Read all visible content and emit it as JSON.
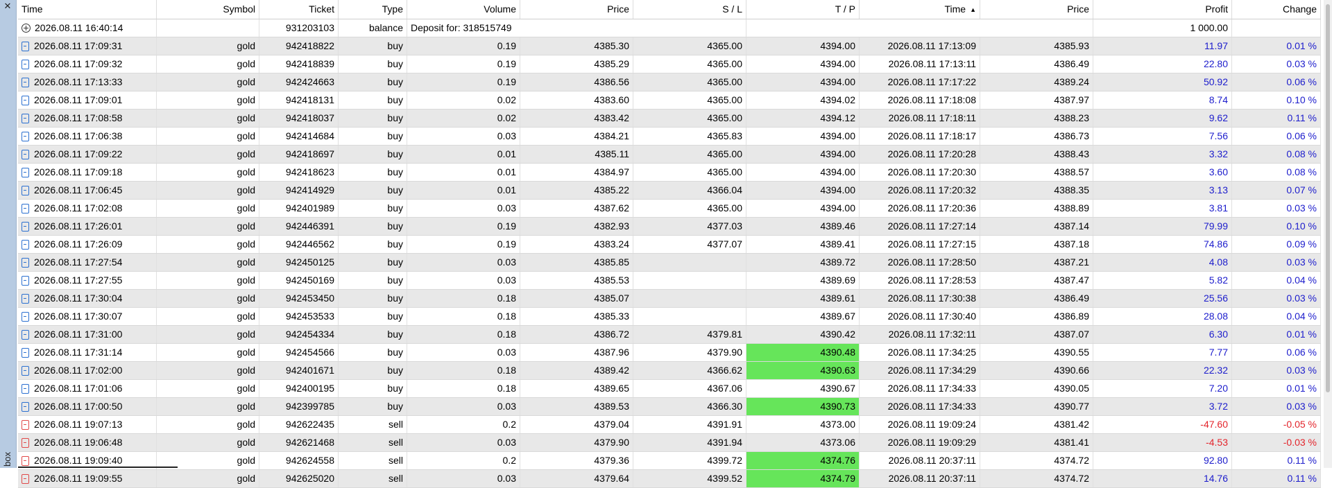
{
  "sidebar": {
    "close_glyph": "✕",
    "label": "box"
  },
  "columns": [
    "Time",
    "Symbol",
    "Ticket",
    "Type",
    "Volume",
    "Price",
    "S / L",
    "T / P",
    "Time",
    "Price",
    "Profit",
    "Change"
  ],
  "sort_indicator": "▲",
  "balance_row": {
    "time": "2026.08.11 16:40:14",
    "ticket": "931203103",
    "type": "balance",
    "comment": "Deposit for: 318515749",
    "profit": "1 000.00"
  },
  "rows": [
    {
      "time": "2026.08.11 17:09:31",
      "symbol": "gold",
      "ticket": "942418822",
      "type": "buy",
      "volume": "0.19",
      "price": "4385.30",
      "sl": "4365.00",
      "tp": "4394.00",
      "close_time": "2026.08.11 17:13:09",
      "close_price": "4385.93",
      "profit": "11.97",
      "change": "0.01 %",
      "tp_hit": false
    },
    {
      "time": "2026.08.11 17:09:32",
      "symbol": "gold",
      "ticket": "942418839",
      "type": "buy",
      "volume": "0.19",
      "price": "4385.29",
      "sl": "4365.00",
      "tp": "4394.00",
      "close_time": "2026.08.11 17:13:11",
      "close_price": "4386.49",
      "profit": "22.80",
      "change": "0.03 %",
      "tp_hit": false
    },
    {
      "time": "2026.08.11 17:13:33",
      "symbol": "gold",
      "ticket": "942424663",
      "type": "buy",
      "volume": "0.19",
      "price": "4386.56",
      "sl": "4365.00",
      "tp": "4394.00",
      "close_time": "2026.08.11 17:17:22",
      "close_price": "4389.24",
      "profit": "50.92",
      "change": "0.06 %",
      "tp_hit": false
    },
    {
      "time": "2026.08.11 17:09:01",
      "symbol": "gold",
      "ticket": "942418131",
      "type": "buy",
      "volume": "0.02",
      "price": "4383.60",
      "sl": "4365.00",
      "tp": "4394.02",
      "close_time": "2026.08.11 17:18:08",
      "close_price": "4387.97",
      "profit": "8.74",
      "change": "0.10 %",
      "tp_hit": false
    },
    {
      "time": "2026.08.11 17:08:58",
      "symbol": "gold",
      "ticket": "942418037",
      "type": "buy",
      "volume": "0.02",
      "price": "4383.42",
      "sl": "4365.00",
      "tp": "4394.12",
      "close_time": "2026.08.11 17:18:11",
      "close_price": "4388.23",
      "profit": "9.62",
      "change": "0.11 %",
      "tp_hit": false
    },
    {
      "time": "2026.08.11 17:06:38",
      "symbol": "gold",
      "ticket": "942414684",
      "type": "buy",
      "volume": "0.03",
      "price": "4384.21",
      "sl": "4365.83",
      "tp": "4394.00",
      "close_time": "2026.08.11 17:18:17",
      "close_price": "4386.73",
      "profit": "7.56",
      "change": "0.06 %",
      "tp_hit": false
    },
    {
      "time": "2026.08.11 17:09:22",
      "symbol": "gold",
      "ticket": "942418697",
      "type": "buy",
      "volume": "0.01",
      "price": "4385.11",
      "sl": "4365.00",
      "tp": "4394.00",
      "close_time": "2026.08.11 17:20:28",
      "close_price": "4388.43",
      "profit": "3.32",
      "change": "0.08 %",
      "tp_hit": false
    },
    {
      "time": "2026.08.11 17:09:18",
      "symbol": "gold",
      "ticket": "942418623",
      "type": "buy",
      "volume": "0.01",
      "price": "4384.97",
      "sl": "4365.00",
      "tp": "4394.00",
      "close_time": "2026.08.11 17:20:30",
      "close_price": "4388.57",
      "profit": "3.60",
      "change": "0.08 %",
      "tp_hit": false
    },
    {
      "time": "2026.08.11 17:06:45",
      "symbol": "gold",
      "ticket": "942414929",
      "type": "buy",
      "volume": "0.01",
      "price": "4385.22",
      "sl": "4366.04",
      "tp": "4394.00",
      "close_time": "2026.08.11 17:20:32",
      "close_price": "4388.35",
      "profit": "3.13",
      "change": "0.07 %",
      "tp_hit": false
    },
    {
      "time": "2026.08.11 17:02:08",
      "symbol": "gold",
      "ticket": "942401989",
      "type": "buy",
      "volume": "0.03",
      "price": "4387.62",
      "sl": "4365.00",
      "tp": "4394.00",
      "close_time": "2026.08.11 17:20:36",
      "close_price": "4388.89",
      "profit": "3.81",
      "change": "0.03 %",
      "tp_hit": false
    },
    {
      "time": "2026.08.11 17:26:01",
      "symbol": "gold",
      "ticket": "942446391",
      "type": "buy",
      "volume": "0.19",
      "price": "4382.93",
      "sl": "4377.03",
      "tp": "4389.46",
      "close_time": "2026.08.11 17:27:14",
      "close_price": "4387.14",
      "profit": "79.99",
      "change": "0.10 %",
      "tp_hit": false
    },
    {
      "time": "2026.08.11 17:26:09",
      "symbol": "gold",
      "ticket": "942446562",
      "type": "buy",
      "volume": "0.19",
      "price": "4383.24",
      "sl": "4377.07",
      "tp": "4389.41",
      "close_time": "2026.08.11 17:27:15",
      "close_price": "4387.18",
      "profit": "74.86",
      "change": "0.09 %",
      "tp_hit": false
    },
    {
      "time": "2026.08.11 17:27:54",
      "symbol": "gold",
      "ticket": "942450125",
      "type": "buy",
      "volume": "0.03",
      "price": "4385.85",
      "sl": "",
      "tp": "4389.72",
      "close_time": "2026.08.11 17:28:50",
      "close_price": "4387.21",
      "profit": "4.08",
      "change": "0.03 %",
      "tp_hit": false
    },
    {
      "time": "2026.08.11 17:27:55",
      "symbol": "gold",
      "ticket": "942450169",
      "type": "buy",
      "volume": "0.03",
      "price": "4385.53",
      "sl": "",
      "tp": "4389.69",
      "close_time": "2026.08.11 17:28:53",
      "close_price": "4387.47",
      "profit": "5.82",
      "change": "0.04 %",
      "tp_hit": false
    },
    {
      "time": "2026.08.11 17:30:04",
      "symbol": "gold",
      "ticket": "942453450",
      "type": "buy",
      "volume": "0.18",
      "price": "4385.07",
      "sl": "",
      "tp": "4389.61",
      "close_time": "2026.08.11 17:30:38",
      "close_price": "4386.49",
      "profit": "25.56",
      "change": "0.03 %",
      "tp_hit": false
    },
    {
      "time": "2026.08.11 17:30:07",
      "symbol": "gold",
      "ticket": "942453533",
      "type": "buy",
      "volume": "0.18",
      "price": "4385.33",
      "sl": "",
      "tp": "4389.67",
      "close_time": "2026.08.11 17:30:40",
      "close_price": "4386.89",
      "profit": "28.08",
      "change": "0.04 %",
      "tp_hit": false
    },
    {
      "time": "2026.08.11 17:31:00",
      "symbol": "gold",
      "ticket": "942454334",
      "type": "buy",
      "volume": "0.18",
      "price": "4386.72",
      "sl": "4379.81",
      "tp": "4390.42",
      "close_time": "2026.08.11 17:32:11",
      "close_price": "4387.07",
      "profit": "6.30",
      "change": "0.01 %",
      "tp_hit": false
    },
    {
      "time": "2026.08.11 17:31:14",
      "symbol": "gold",
      "ticket": "942454566",
      "type": "buy",
      "volume": "0.03",
      "price": "4387.96",
      "sl": "4379.90",
      "tp": "4390.48",
      "close_time": "2026.08.11 17:34:25",
      "close_price": "4390.55",
      "profit": "7.77",
      "change": "0.06 %",
      "tp_hit": true
    },
    {
      "time": "2026.08.11 17:02:00",
      "symbol": "gold",
      "ticket": "942401671",
      "type": "buy",
      "volume": "0.18",
      "price": "4389.42",
      "sl": "4366.62",
      "tp": "4390.63",
      "close_time": "2026.08.11 17:34:29",
      "close_price": "4390.66",
      "profit": "22.32",
      "change": "0.03 %",
      "tp_hit": true
    },
    {
      "time": "2026.08.11 17:01:06",
      "symbol": "gold",
      "ticket": "942400195",
      "type": "buy",
      "volume": "0.18",
      "price": "4389.65",
      "sl": "4367.06",
      "tp": "4390.67",
      "close_time": "2026.08.11 17:34:33",
      "close_price": "4390.05",
      "profit": "7.20",
      "change": "0.01 %",
      "tp_hit": false
    },
    {
      "time": "2026.08.11 17:00:50",
      "symbol": "gold",
      "ticket": "942399785",
      "type": "buy",
      "volume": "0.03",
      "price": "4389.53",
      "sl": "4366.30",
      "tp": "4390.73",
      "close_time": "2026.08.11 17:34:33",
      "close_price": "4390.77",
      "profit": "3.72",
      "change": "0.03 %",
      "tp_hit": true
    },
    {
      "time": "2026.08.11 19:07:13",
      "symbol": "gold",
      "ticket": "942622435",
      "type": "sell",
      "volume": "0.2",
      "price": "4379.04",
      "sl": "4391.91",
      "tp": "4373.00",
      "close_time": "2026.08.11 19:09:24",
      "close_price": "4381.42",
      "profit": "-47.60",
      "change": "-0.05 %",
      "tp_hit": false
    },
    {
      "time": "2026.08.11 19:06:48",
      "symbol": "gold",
      "ticket": "942621468",
      "type": "sell",
      "volume": "0.03",
      "price": "4379.90",
      "sl": "4391.94",
      "tp": "4373.06",
      "close_time": "2026.08.11 19:09:29",
      "close_price": "4381.41",
      "profit": "-4.53",
      "change": "-0.03 %",
      "tp_hit": false
    },
    {
      "time": "2026.08.11 19:09:40",
      "symbol": "gold",
      "ticket": "942624558",
      "type": "sell",
      "volume": "0.2",
      "price": "4379.36",
      "sl": "4399.72",
      "tp": "4374.76",
      "close_time": "2026.08.11 20:37:11",
      "close_price": "4374.72",
      "profit": "92.80",
      "change": "0.11 %",
      "tp_hit": true
    },
    {
      "time": "2026.08.11 19:09:55",
      "symbol": "gold",
      "ticket": "942625020",
      "type": "sell",
      "volume": "0.03",
      "price": "4379.64",
      "sl": "4399.52",
      "tp": "4374.79",
      "close_time": "2026.08.11 20:37:11",
      "close_price": "4374.72",
      "profit": "14.76",
      "change": "0.11 %",
      "tp_hit": true
    }
  ],
  "colors": {
    "positive": "#1c1ccc",
    "negative": "#e3242b",
    "tp_hit": "#66e55a",
    "shade": "#e8e8e8",
    "sidebar": "#b7cbe2"
  },
  "icons": {
    "close": "close-icon",
    "balance": "plus-circle-icon",
    "deal": "document-icon",
    "sort": "sort-asc-icon"
  }
}
